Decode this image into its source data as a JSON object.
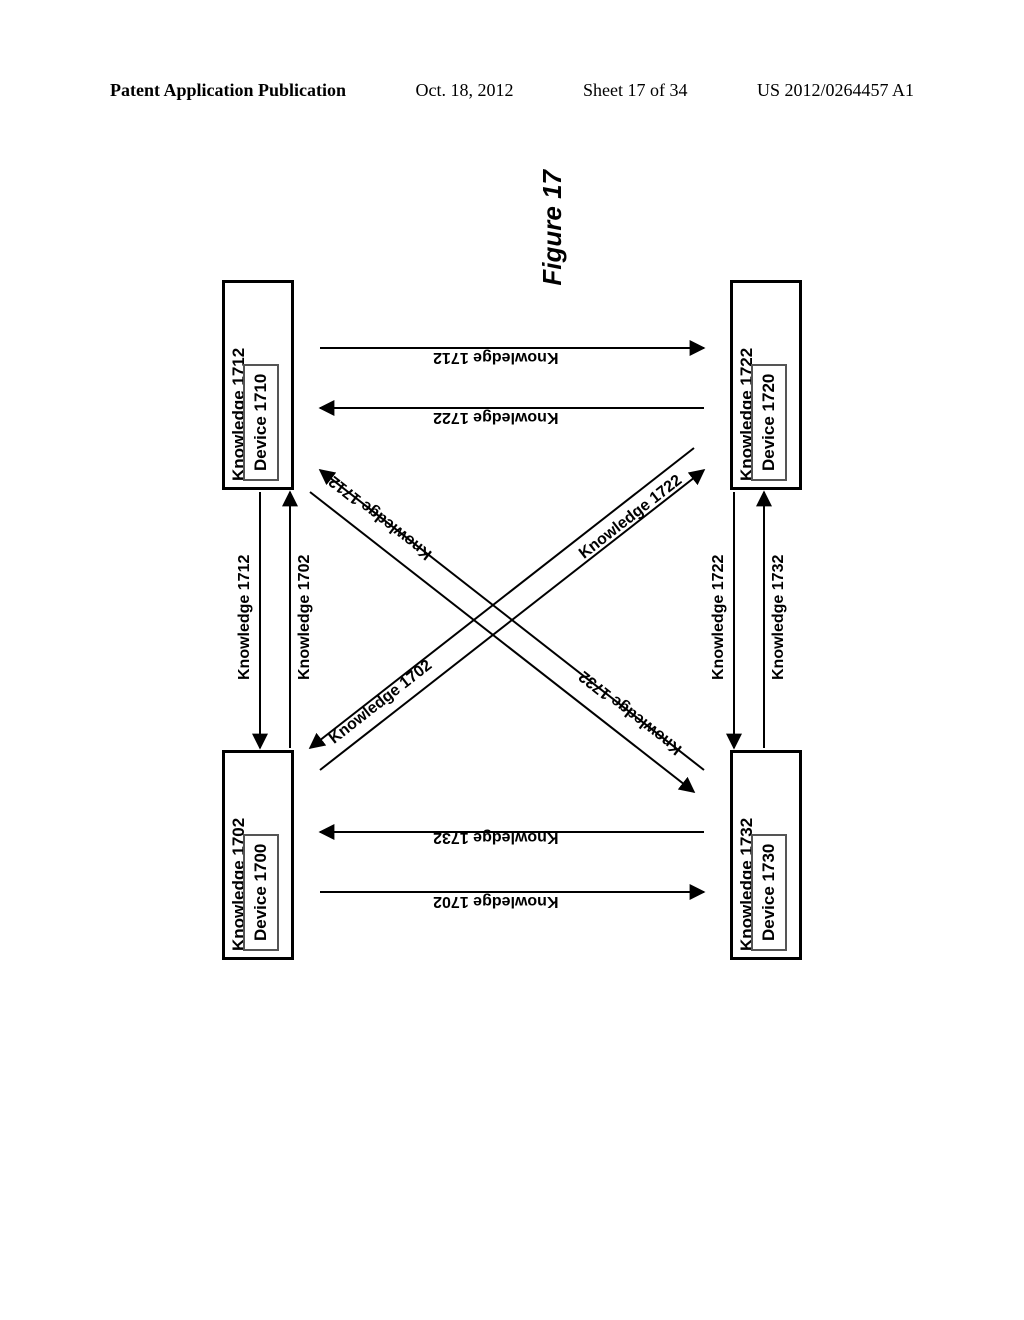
{
  "header": {
    "publication": "Patent Application Publication",
    "date": "Oct. 18, 2012",
    "sheet": "Sheet 17 of 34",
    "pubno": "US 2012/0264457 A1"
  },
  "figure_caption": "Figure 17",
  "nodes": {
    "d1700": {
      "knowledge": "Knowledge 1702",
      "device": "Device 1700"
    },
    "d1710": {
      "knowledge": "Knowledge 1712",
      "device": "Device 1710"
    },
    "d1720": {
      "knowledge": "Knowledge 1722",
      "device": "Device 1720"
    },
    "d1730": {
      "knowledge": "Knowledge 1732",
      "device": "Device 1730"
    }
  },
  "edge_labels": {
    "top_upper": "Knowledge 1712",
    "top_lower": "Knowledge 1702",
    "bottom_upper": "Knowledge 1722",
    "bottom_lower": "Knowledge 1732",
    "left_upper": "Knowledge 1702",
    "left_lower": "Knowledge 1732",
    "right_upper": "Knowledge 1722",
    "right_lower": "Knowledge 1712",
    "diag_tl": "Knowledge 1702",
    "diag_tr": "Knowledge 1712",
    "diag_bl": "Knowledge 1732",
    "diag_br": "Knowledge 1722"
  },
  "chart_data": {
    "type": "diagram",
    "title": "Figure 17",
    "nodes": [
      {
        "id": "1700",
        "label": "Device 1700",
        "knowledge": "Knowledge 1702"
      },
      {
        "id": "1710",
        "label": "Device 1710",
        "knowledge": "Knowledge 1712"
      },
      {
        "id": "1720",
        "label": "Device 1720",
        "knowledge": "Knowledge 1722"
      },
      {
        "id": "1730",
        "label": "Device 1730",
        "knowledge": "Knowledge 1732"
      }
    ],
    "edges": [
      {
        "from": "1700",
        "to": "1710",
        "label": "Knowledge 1702"
      },
      {
        "from": "1710",
        "to": "1700",
        "label": "Knowledge 1712"
      },
      {
        "from": "1700",
        "to": "1730",
        "label": "Knowledge 1702"
      },
      {
        "from": "1730",
        "to": "1700",
        "label": "Knowledge 1732"
      },
      {
        "from": "1710",
        "to": "1720",
        "label": "Knowledge 1712"
      },
      {
        "from": "1720",
        "to": "1710",
        "label": "Knowledge 1722"
      },
      {
        "from": "1730",
        "to": "1720",
        "label": "Knowledge 1732"
      },
      {
        "from": "1720",
        "to": "1730",
        "label": "Knowledge 1722"
      },
      {
        "from": "1700",
        "to": "1720",
        "label": "Knowledge 1702"
      },
      {
        "from": "1720",
        "to": "1700",
        "label": "Knowledge 1722"
      },
      {
        "from": "1710",
        "to": "1730",
        "label": "Knowledge 1712"
      },
      {
        "from": "1730",
        "to": "1710",
        "label": "Knowledge 1732"
      }
    ]
  }
}
